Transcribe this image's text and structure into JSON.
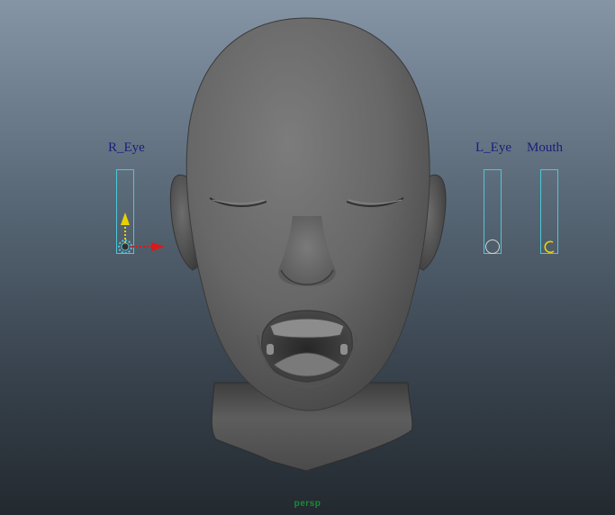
{
  "controls": {
    "r_eye": {
      "label": "R_Eye",
      "value": 0,
      "selected": true,
      "knob_color": "#c9c9c9",
      "manipulator": {
        "y_axis_color": "#e6d200",
        "x_axis_color": "#d81a1a",
        "center_color": "#4fc6d6"
      }
    },
    "l_eye": {
      "label": "L_Eye",
      "value": 0,
      "selected": false,
      "knob_color": "#d4d4d4"
    },
    "mouth": {
      "label": "Mouth",
      "value": 0,
      "selected": false,
      "knob_color": "#e6d200"
    }
  },
  "colors": {
    "label_text": "#1a1f7a",
    "slider_border": "#4fc6d6",
    "camera_label": "#1a8a3a",
    "head_fill": "#6e6e6e",
    "head_shadow": "#3f3f3f"
  },
  "viewport": {
    "camera": "persp"
  },
  "icons": {
    "manipulator": "move-manipulator-icon",
    "head_model": "head-mesh-icon"
  }
}
